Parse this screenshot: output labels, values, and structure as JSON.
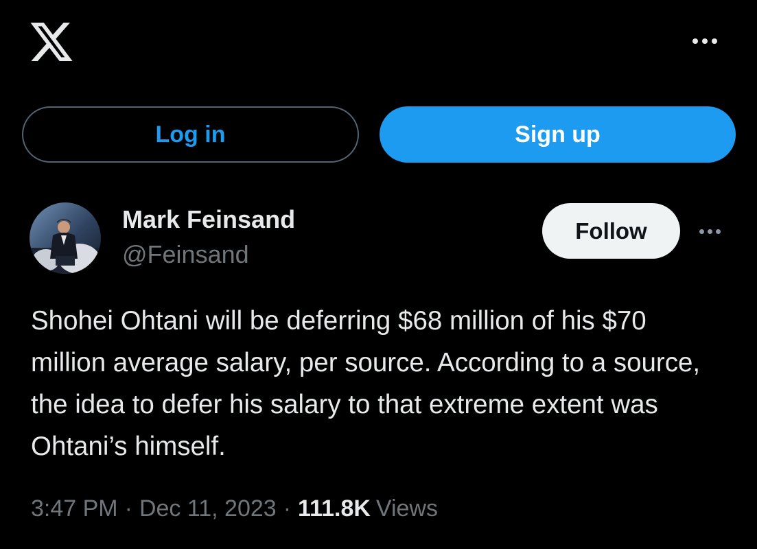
{
  "topbar": {
    "logo_icon": "x-logo-icon",
    "more_icon": "more-horizontal-icon"
  },
  "auth": {
    "login_label": "Log in",
    "signup_label": "Sign up"
  },
  "tweet": {
    "author": {
      "name": "Mark Feinsand",
      "handle": "@Feinsand",
      "avatar_icon": "avatar"
    },
    "follow_label": "Follow",
    "more_icon": "more-horizontal-icon",
    "text": "Shohei Ohtani will be deferring $68 million of his $70 million average salary, per source. According to a source, the idea to defer his salary to that extreme extent was Ohtani’s himself.",
    "time": "3:47 PM",
    "separator": "·",
    "date": "Dec 11, 2023",
    "views_count": "111.8K",
    "views_label": "Views"
  },
  "colors": {
    "background": "#000000",
    "text_primary": "#e7e9ea",
    "text_secondary": "#71767b",
    "accent": "#1d9bf0",
    "follow_bg": "#eff3f4",
    "border": "#536471"
  }
}
